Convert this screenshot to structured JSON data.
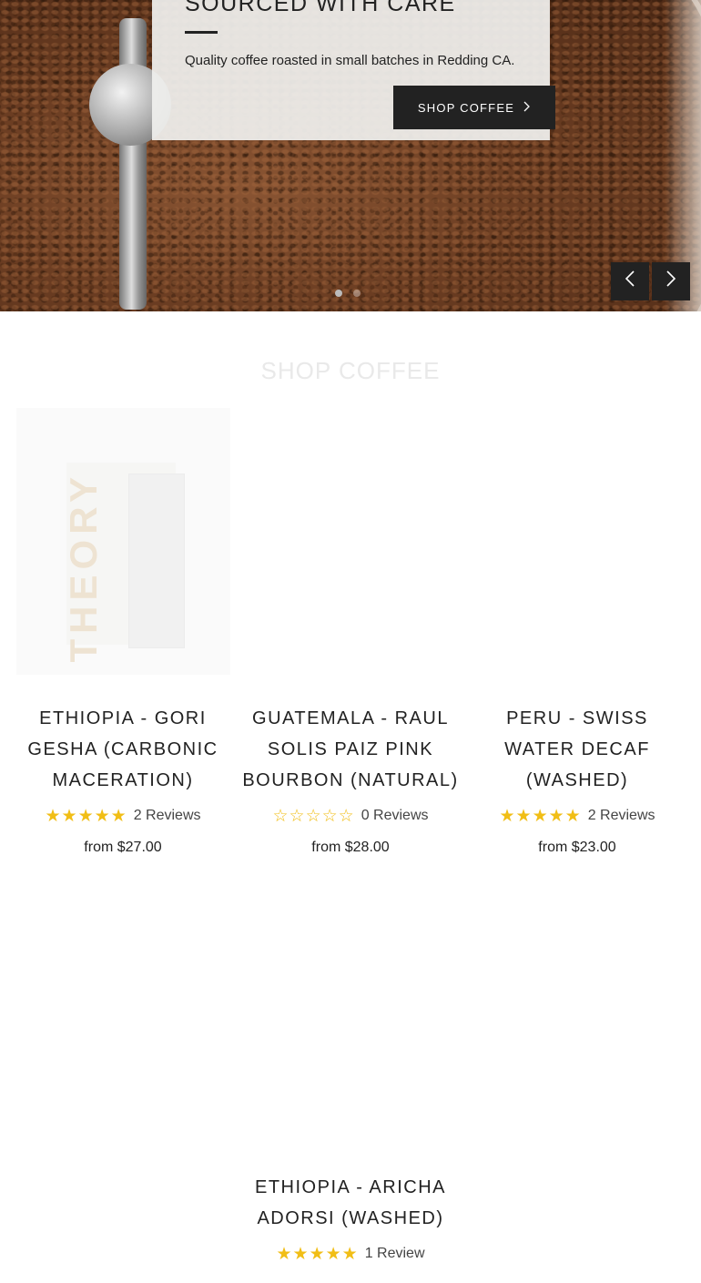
{
  "hero": {
    "title": "SOURCED WITH CARE",
    "subtitle": "Quality coffee roasted in small batches in Redding CA.",
    "button_label": "SHOP COFFEE",
    "button_icon": "chevron-right-icon",
    "slide_count": 2,
    "active_slide": 1,
    "prev_icon": "chevron-left-icon",
    "next_icon": "chevron-right-icon"
  },
  "section": {
    "title": "SHOP COFFEE"
  },
  "products": [
    {
      "name": "ETHIOPIA - GORI GESHA (CARBONIC MACERATION)",
      "rating": 5,
      "reviews": "2 Reviews",
      "price": "from $27.00",
      "image_text": "THEORY"
    },
    {
      "name": "GUATEMALA - RAUL SOLIS PAIZ PINK BOURBON (NATURAL)",
      "rating": 0,
      "reviews": "0 Reviews",
      "price": "from $28.00"
    },
    {
      "name": "PERU - SWISS WATER DECAF (WASHED)",
      "rating": 5,
      "reviews": "2 Reviews",
      "price": "from $23.00"
    },
    {
      "name": "ETHIOPIA - ARICHA ADORSI (WASHED)",
      "rating": 5,
      "reviews": "1 Review"
    }
  ],
  "colors": {
    "dark": "#222222",
    "star": "#f1be16",
    "section_title": "#e9e9e9"
  }
}
